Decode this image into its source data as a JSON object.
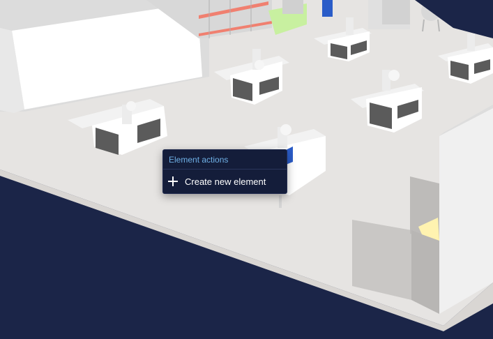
{
  "context_menu": {
    "title": "Element actions",
    "items": [
      {
        "label": "Create new element",
        "icon": "plus-icon"
      }
    ]
  },
  "colors": {
    "background": "#1b2548",
    "floor": "#e5e3e1",
    "menu_background": "#141d3a",
    "menu_title": "#6fb0e6",
    "menu_text": "#ffffff",
    "accent_orange": "#f08070",
    "accent_blue": "#2a5cc8",
    "accent_yellow": "#fff3b0",
    "accent_green": "#c8f0a0"
  }
}
